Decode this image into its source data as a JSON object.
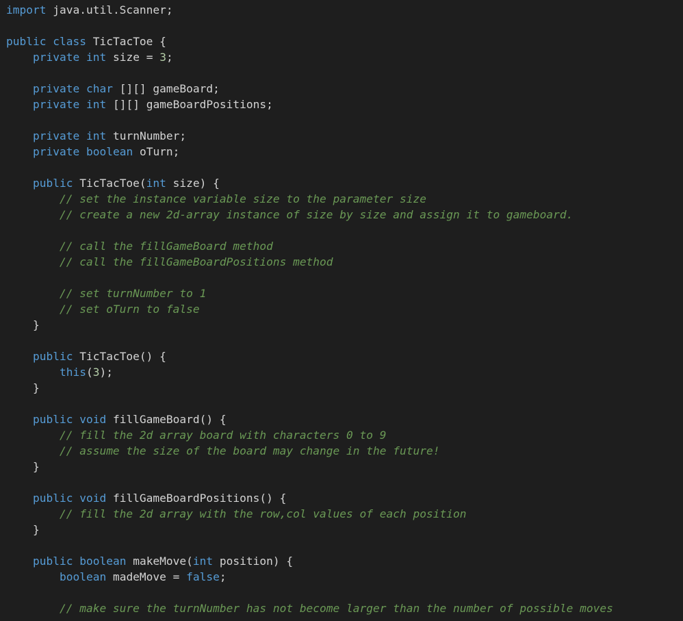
{
  "editor": {
    "colors": {
      "background": "#1e1e1e",
      "keyword": "#569cd6",
      "number": "#b5cea8",
      "comment": "#6a9955",
      "text": "#d4d4d4"
    },
    "lines": [
      [
        {
          "t": "kw",
          "v": "import"
        },
        {
          "t": "tx",
          "v": " java.util.Scanner;"
        }
      ],
      [],
      [
        {
          "t": "kw",
          "v": "public"
        },
        {
          "t": "tx",
          "v": " "
        },
        {
          "t": "kw",
          "v": "class"
        },
        {
          "t": "tx",
          "v": " TicTacToe {"
        }
      ],
      [
        {
          "t": "tx",
          "v": "    "
        },
        {
          "t": "kw",
          "v": "private"
        },
        {
          "t": "tx",
          "v": " "
        },
        {
          "t": "kw",
          "v": "int"
        },
        {
          "t": "tx",
          "v": " size = "
        },
        {
          "t": "num",
          "v": "3"
        },
        {
          "t": "tx",
          "v": ";"
        }
      ],
      [],
      [
        {
          "t": "tx",
          "v": "    "
        },
        {
          "t": "kw",
          "v": "private"
        },
        {
          "t": "tx",
          "v": " "
        },
        {
          "t": "kw",
          "v": "char"
        },
        {
          "t": "tx",
          "v": " [][] gameBoard;"
        }
      ],
      [
        {
          "t": "tx",
          "v": "    "
        },
        {
          "t": "kw",
          "v": "private"
        },
        {
          "t": "tx",
          "v": " "
        },
        {
          "t": "kw",
          "v": "int"
        },
        {
          "t": "tx",
          "v": " [][] gameBoardPositions;"
        }
      ],
      [],
      [
        {
          "t": "tx",
          "v": "    "
        },
        {
          "t": "kw",
          "v": "private"
        },
        {
          "t": "tx",
          "v": " "
        },
        {
          "t": "kw",
          "v": "int"
        },
        {
          "t": "tx",
          "v": " turnNumber;"
        }
      ],
      [
        {
          "t": "tx",
          "v": "    "
        },
        {
          "t": "kw",
          "v": "private"
        },
        {
          "t": "tx",
          "v": " "
        },
        {
          "t": "kw",
          "v": "boolean"
        },
        {
          "t": "tx",
          "v": " oTurn;"
        }
      ],
      [],
      [
        {
          "t": "tx",
          "v": "    "
        },
        {
          "t": "kw",
          "v": "public"
        },
        {
          "t": "tx",
          "v": " TicTacToe("
        },
        {
          "t": "kw",
          "v": "int"
        },
        {
          "t": "tx",
          "v": " size) {"
        }
      ],
      [
        {
          "t": "tx",
          "v": "        "
        },
        {
          "t": "cm",
          "v": "// set the instance variable size to the parameter size"
        }
      ],
      [
        {
          "t": "tx",
          "v": "        "
        },
        {
          "t": "cm",
          "v": "// create a new 2d-array instance of size by size and assign it to gameboard."
        }
      ],
      [],
      [
        {
          "t": "tx",
          "v": "        "
        },
        {
          "t": "cm",
          "v": "// call the fillGameBoard method"
        }
      ],
      [
        {
          "t": "tx",
          "v": "        "
        },
        {
          "t": "cm",
          "v": "// call the fillGameBoardPositions method"
        }
      ],
      [],
      [
        {
          "t": "tx",
          "v": "        "
        },
        {
          "t": "cm",
          "v": "// set turnNumber to 1"
        }
      ],
      [
        {
          "t": "tx",
          "v": "        "
        },
        {
          "t": "cm",
          "v": "// set oTurn to false"
        }
      ],
      [
        {
          "t": "tx",
          "v": "    }"
        }
      ],
      [],
      [
        {
          "t": "tx",
          "v": "    "
        },
        {
          "t": "kw",
          "v": "public"
        },
        {
          "t": "tx",
          "v": " TicTacToe() {"
        }
      ],
      [
        {
          "t": "tx",
          "v": "        "
        },
        {
          "t": "kw",
          "v": "this"
        },
        {
          "t": "tx",
          "v": "("
        },
        {
          "t": "num",
          "v": "3"
        },
        {
          "t": "tx",
          "v": ");"
        }
      ],
      [
        {
          "t": "tx",
          "v": "    }"
        }
      ],
      [],
      [
        {
          "t": "tx",
          "v": "    "
        },
        {
          "t": "kw",
          "v": "public"
        },
        {
          "t": "tx",
          "v": " "
        },
        {
          "t": "kw",
          "v": "void"
        },
        {
          "t": "tx",
          "v": " fillGameBoard() {"
        }
      ],
      [
        {
          "t": "tx",
          "v": "        "
        },
        {
          "t": "cm",
          "v": "// fill the 2d array board with characters 0 to 9"
        }
      ],
      [
        {
          "t": "tx",
          "v": "        "
        },
        {
          "t": "cm",
          "v": "// assume the size of the board may change in the future!"
        }
      ],
      [
        {
          "t": "tx",
          "v": "    }"
        }
      ],
      [],
      [
        {
          "t": "tx",
          "v": "    "
        },
        {
          "t": "kw",
          "v": "public"
        },
        {
          "t": "tx",
          "v": " "
        },
        {
          "t": "kw",
          "v": "void"
        },
        {
          "t": "tx",
          "v": " fillGameBoardPositions() {"
        }
      ],
      [
        {
          "t": "tx",
          "v": "        "
        },
        {
          "t": "cm",
          "v": "// fill the 2d array with the row,col values of each position"
        }
      ],
      [
        {
          "t": "tx",
          "v": "    }"
        }
      ],
      [],
      [
        {
          "t": "tx",
          "v": "    "
        },
        {
          "t": "kw",
          "v": "public"
        },
        {
          "t": "tx",
          "v": " "
        },
        {
          "t": "kw",
          "v": "boolean"
        },
        {
          "t": "tx",
          "v": " makeMove("
        },
        {
          "t": "kw",
          "v": "int"
        },
        {
          "t": "tx",
          "v": " position) {"
        }
      ],
      [
        {
          "t": "tx",
          "v": "        "
        },
        {
          "t": "kw",
          "v": "boolean"
        },
        {
          "t": "tx",
          "v": " madeMove = "
        },
        {
          "t": "kw",
          "v": "false"
        },
        {
          "t": "tx",
          "v": ";"
        }
      ],
      [],
      [
        {
          "t": "tx",
          "v": "        "
        },
        {
          "t": "cm",
          "v": "// make sure the turnNumber has not become larger than the number of possible moves"
        }
      ]
    ]
  }
}
